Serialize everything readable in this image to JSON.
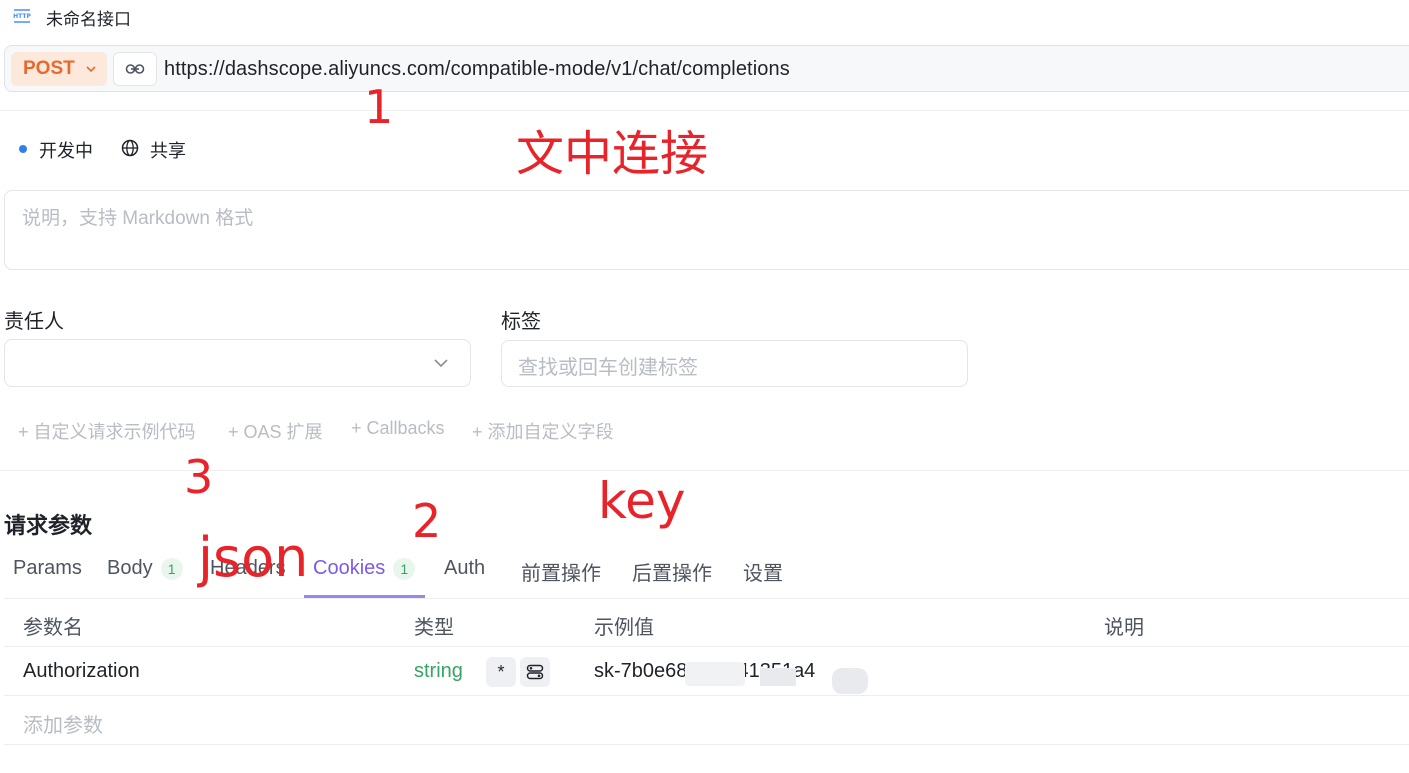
{
  "header": {
    "title": "未命名接口",
    "icon": "http-icon"
  },
  "request": {
    "method": "POST",
    "url": "https://dashscope.aliyuncs.com/compatible-mode/v1/chat/completions",
    "method_color": "#e8692f"
  },
  "status": {
    "label": "开发中",
    "share_label": "共享",
    "dot_color": "#2f80ed"
  },
  "description": {
    "placeholder": "说明，支持 Markdown 格式"
  },
  "fields": {
    "owner_label": "责任人",
    "tags_label": "标签",
    "tags_placeholder": "查找或回车创建标签"
  },
  "extensions": [
    "+ 自定义请求示例代码",
    "+ OAS 扩展",
    "+ Callbacks",
    "+ 添加自定义字段"
  ],
  "section": {
    "title": "请求参数"
  },
  "tabs": [
    {
      "label": "Params"
    },
    {
      "label": "Body",
      "badge": "1"
    },
    {
      "label": "Headers"
    },
    {
      "label": "Cookies",
      "badge": "1",
      "active": true
    },
    {
      "label": "Auth"
    },
    {
      "label": "前置操作"
    },
    {
      "label": "后置操作"
    },
    {
      "label": "设置"
    }
  ],
  "table": {
    "columns": [
      "参数名",
      "类型",
      "示例值",
      "说明"
    ],
    "rows": [
      {
        "name": "Authorization",
        "type": "string",
        "required_mark": "*",
        "value": "sk-7b0e68  341741351a4"
      }
    ],
    "add_placeholder": "添加参数"
  },
  "annotations": {
    "n1": "1",
    "link_note": "文中连接",
    "n3": "3",
    "n2": "2",
    "key_note": "key",
    "json_note": "json"
  },
  "colors": {
    "accent": "#7b5ce6",
    "annotation": "#e8232a",
    "type_green": "#35a564"
  }
}
